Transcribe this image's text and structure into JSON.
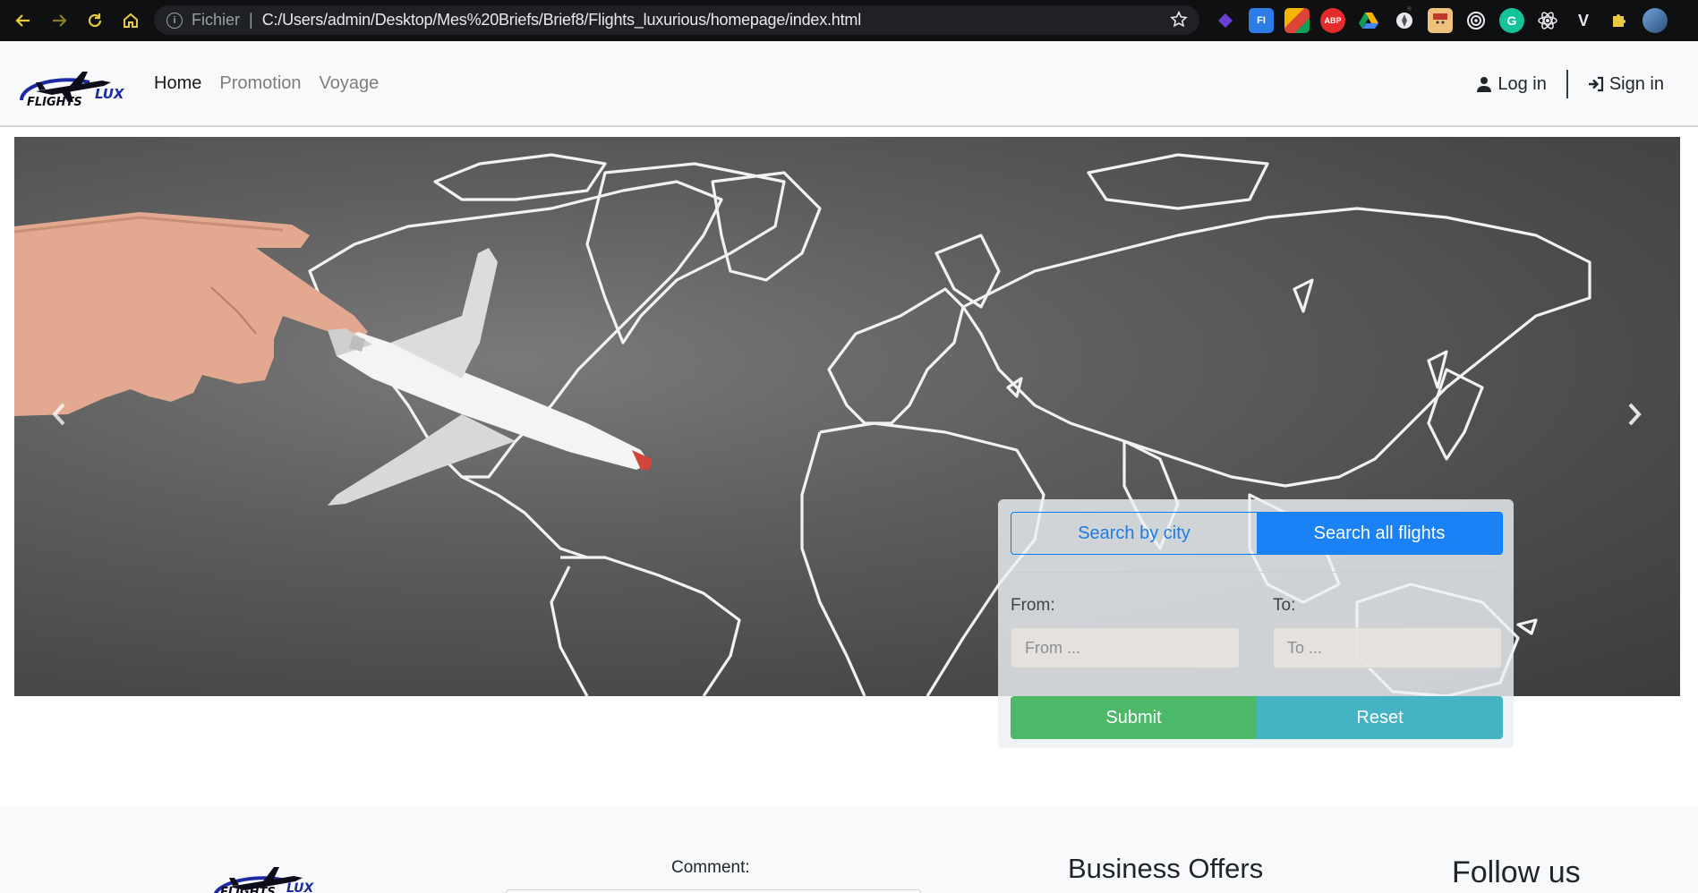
{
  "browser": {
    "site_label": "Fichier",
    "separator": "|",
    "url": "C:/Users/admin/Desktop/Mes%20Briefs/Brief8/Flights_luxurious/homepage/index.html",
    "extensions": [
      "ext-purple",
      "ext-fi",
      "ext-google-keep",
      "ext-abp",
      "ext-drive",
      "ext-compass",
      "ext-face",
      "ext-target",
      "ext-grammarly",
      "ext-react",
      "ext-v",
      "ext-puzzle",
      "ext-profile"
    ],
    "ext_labels": {
      "fi": "FI",
      "abp": "ABP",
      "grammarly": "G",
      "v": "V"
    }
  },
  "navbar": {
    "logo_text_main": "FLIGHTS",
    "logo_text_lux": "LUX",
    "links": [
      {
        "label": "Home",
        "active": true
      },
      {
        "label": "Promotion",
        "active": false
      },
      {
        "label": "Voyage",
        "active": false
      }
    ],
    "login_label": "Log in",
    "signin_label": "Sign in"
  },
  "search": {
    "tab_city": "Search by city",
    "tab_all": "Search all flights",
    "from_label": "From:",
    "to_label": "To:",
    "from_placeholder": "From ...",
    "to_placeholder": "To ...",
    "submit_label": "Submit",
    "reset_label": "Reset"
  },
  "footer": {
    "comment_label": "Comment:",
    "business_heading": "Business Offers",
    "follow_heading": "Follow us"
  },
  "colors": {
    "primary": "#1a82f5",
    "success": "#4cb969",
    "info": "#45b3c4",
    "accent_browser": "#e8c93f"
  }
}
